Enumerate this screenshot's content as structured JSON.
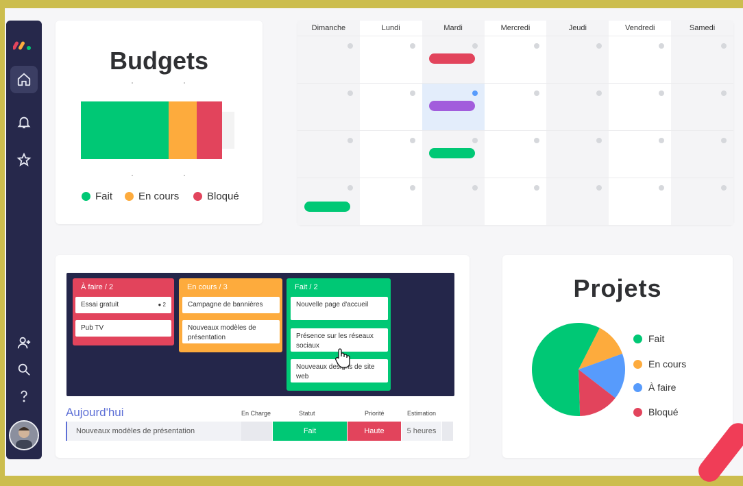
{
  "colors": {
    "done": "#00c875",
    "working": "#fdab3d",
    "stuck": "#e2445c",
    "todo": "#579bfc",
    "purple": "#a25ddc",
    "accent": "#5d6fd6",
    "sidebar": "#26284b"
  },
  "sidebar": {
    "icons": [
      "home-icon",
      "bell-icon",
      "star-icon",
      "add-user-icon",
      "search-icon",
      "help-icon"
    ]
  },
  "budgets": {
    "title": "Budgets",
    "segments": [
      {
        "label": "Fait",
        "fraction": 0.62
      },
      {
        "label": "En cours",
        "fraction": 0.2
      },
      {
        "label": "Bloqué",
        "fraction": 0.18
      }
    ],
    "legend": [
      "Fait",
      "En cours",
      "Bloqué"
    ]
  },
  "calendar": {
    "days": [
      "Dimanche",
      "Lundi",
      "Mardi",
      "Mercredi",
      "Jeudi",
      "Vendredi",
      "Samedi"
    ],
    "events": [
      {
        "week": 0,
        "day": 2,
        "color": "stuck"
      },
      {
        "week": 1,
        "day": 2,
        "color": "purple"
      },
      {
        "week": 2,
        "day": 2,
        "color": "done"
      },
      {
        "week": 3,
        "day": 0,
        "color": "done"
      }
    ],
    "highlight": {
      "week": 1,
      "day": 2
    }
  },
  "kanban": {
    "columns": [
      {
        "title": "À faire / 2",
        "color": "stuck",
        "items": [
          {
            "text": "Essai gratuit",
            "badge": "2"
          },
          {
            "text": "Pub TV"
          }
        ]
      },
      {
        "title": "En cours / 3",
        "color": "working",
        "items": [
          {
            "text": "Campagne de bannières"
          },
          {
            "text": "Nouveaux modèles de présentation"
          }
        ]
      },
      {
        "title": "Fait / 2",
        "color": "done",
        "items": [
          {
            "text": "Nouvelle page d'accueil"
          },
          {
            "text": "Présence sur les réseaux sociaux"
          },
          {
            "text": "Nouveaux designs de site web"
          }
        ]
      }
    ]
  },
  "today": {
    "title": "Aujourd'hui",
    "headers": [
      "En Charge",
      "Statut",
      "Priorité",
      "Estimation"
    ],
    "row": {
      "task": "Nouveaux modèles de présentation",
      "status": "Fait",
      "priority": "Haute",
      "estimate": "5 heures"
    }
  },
  "projets": {
    "title": "Projets",
    "slices": [
      {
        "label": "Fait",
        "value": 58
      },
      {
        "label": "En cours",
        "value": 12
      },
      {
        "label": "À faire",
        "value": 16
      },
      {
        "label": "Bloqué",
        "value": 14
      }
    ],
    "legend": [
      "Fait",
      "En cours",
      "À faire",
      "Bloqué"
    ]
  }
}
